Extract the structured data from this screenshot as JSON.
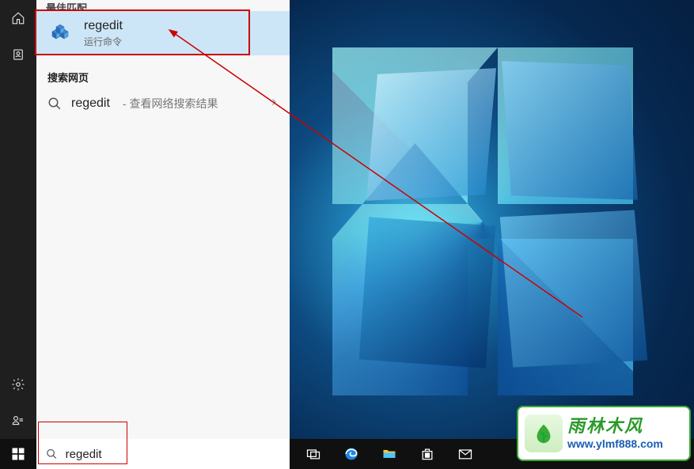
{
  "search": {
    "query": "regedit",
    "best_match_header": "最佳匹配",
    "top_result": {
      "title": "regedit",
      "subtitle": "运行命令"
    },
    "web_header": "搜索网页",
    "web_result": {
      "term": "regedit",
      "suffix": " - 查看网络搜索结果"
    }
  },
  "taskbar": {
    "search_placeholder": ""
  },
  "watermark": {
    "brand": "雨林木风",
    "url": "www.ylmf888.com"
  }
}
